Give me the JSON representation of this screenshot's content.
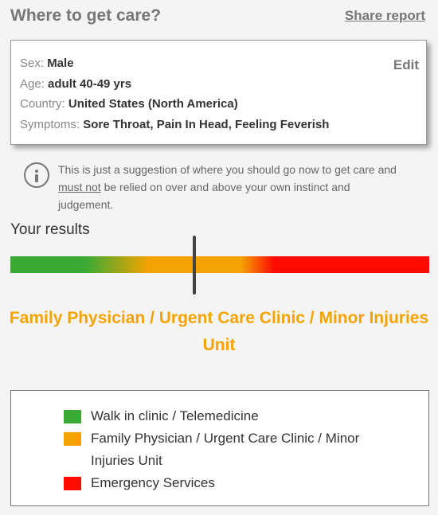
{
  "header": {
    "title": "Where to get care?",
    "share_label": "Share report"
  },
  "summary": {
    "sex_label": "Sex:",
    "sex_value": "Male",
    "age_label": "Age:",
    "age_value": "adult 40-49 yrs",
    "country_label": "Country:",
    "country_value": "United States (North America)",
    "symptoms_label": "Symptoms:",
    "symptoms_value": "Sore Throat, Pain In Head, Feeling Feverish",
    "edit_label": "Edit"
  },
  "notice": {
    "icon": "info-icon",
    "text_before": "This is just a suggestion of where you should go now to get care and ",
    "emphasis": "must not",
    "text_after": " be relied on over and above your own instinct and judgement."
  },
  "results": {
    "label": "Your results",
    "marker_position_fraction": 0.44,
    "result_text": "Family Physician / Urgent Care Clinic / Minor Injuries Unit",
    "result_color": "#f5a300"
  },
  "legend": {
    "items": [
      {
        "label": "Walk in clinic / Telemedicine",
        "color": "#3aaa35"
      },
      {
        "label": "Family Physician / Urgent Care Clinic / Minor Injuries Unit",
        "color": "#f5a300"
      },
      {
        "label": "Emergency Services",
        "color": "#ff0a00"
      }
    ]
  }
}
